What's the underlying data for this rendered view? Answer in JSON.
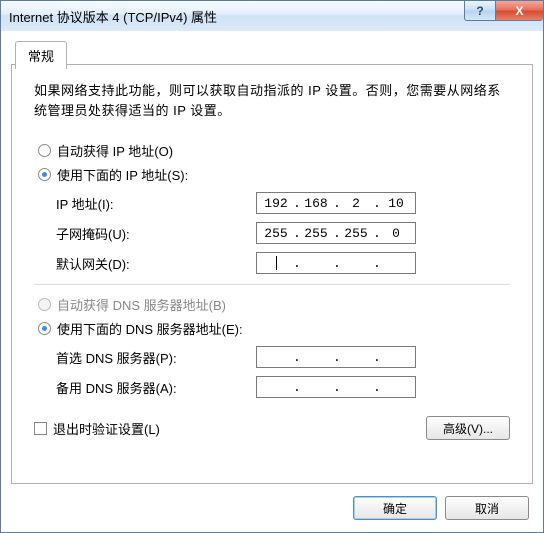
{
  "title": "Internet 协议版本 4 (TCP/IPv4) 属性",
  "help_glyph": "?",
  "close_glyph": "X",
  "tab": {
    "general": "常规"
  },
  "description": "如果网络支持此功能，则可以获取自动指派的 IP 设置。否则，您需要从网络系统管理员处获得适当的 IP 设置。",
  "ip": {
    "auto_label": "自动获得 IP 地址(O)",
    "manual_label": "使用下面的 IP 地址(S):",
    "addr_label": "IP 地址(I):",
    "mask_label": "子网掩码(U):",
    "gw_label": "默认网关(D):",
    "addr": {
      "o1": "192",
      "o2": "168",
      "o3": "2",
      "o4": "10"
    },
    "mask": {
      "o1": "255",
      "o2": "255",
      "o3": "255",
      "o4": "0"
    },
    "gw": {
      "o1": "",
      "o2": "",
      "o3": "",
      "o4": ""
    }
  },
  "dns": {
    "auto_label": "自动获得 DNS 服务器地址(B)",
    "manual_label": "使用下面的 DNS 服务器地址(E):",
    "pref_label": "首选 DNS 服务器(P):",
    "alt_label": "备用 DNS 服务器(A):",
    "pref": {
      "o1": "",
      "o2": "",
      "o3": "",
      "o4": ""
    },
    "alt": {
      "o1": "",
      "o2": "",
      "o3": "",
      "o4": ""
    }
  },
  "validate_label": "退出时验证设置(L)",
  "advanced_label": "高级(V)...",
  "ok_label": "确定",
  "cancel_label": "取消"
}
